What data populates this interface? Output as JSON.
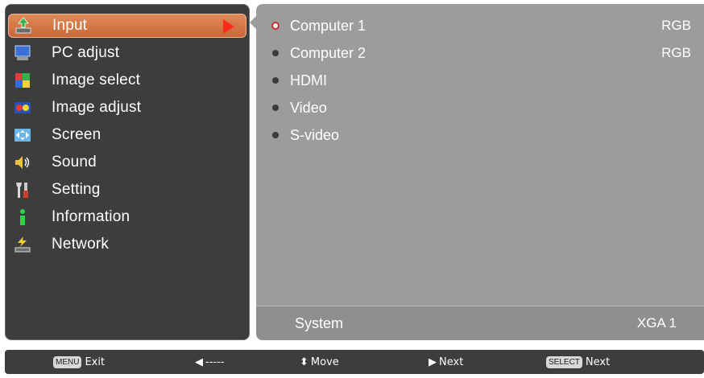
{
  "menu": {
    "items": [
      {
        "label": "Input",
        "icon": "input-icon",
        "selected": true
      },
      {
        "label": "PC adjust",
        "icon": "monitor-icon",
        "selected": false
      },
      {
        "label": "Image select",
        "icon": "image-select-icon",
        "selected": false
      },
      {
        "label": "Image adjust",
        "icon": "image-adjust-icon",
        "selected": false
      },
      {
        "label": "Screen",
        "icon": "screen-icon",
        "selected": false
      },
      {
        "label": "Sound",
        "icon": "speaker-icon",
        "selected": false
      },
      {
        "label": "Setting",
        "icon": "tools-icon",
        "selected": false
      },
      {
        "label": "Information",
        "icon": "info-icon",
        "selected": false
      },
      {
        "label": "Network",
        "icon": "network-icon",
        "selected": false
      }
    ]
  },
  "sources": {
    "items": [
      {
        "name": "Computer 1",
        "signal": "RGB",
        "active": true
      },
      {
        "name": "Computer 2",
        "signal": "RGB",
        "active": false
      },
      {
        "name": "HDMI",
        "signal": "",
        "active": false
      },
      {
        "name": "Video",
        "signal": "",
        "active": false
      },
      {
        "name": "S-video",
        "signal": "",
        "active": false
      }
    ]
  },
  "system": {
    "label": "System",
    "value": "XGA 1"
  },
  "guide": {
    "exit_key": "MENU",
    "exit_label": "Exit",
    "back_glyph": "◀",
    "back_label": "-----",
    "move_glyph": "⬍",
    "move_label": "Move",
    "next_glyph": "▶",
    "next_label": "Next",
    "select_key": "SELECT",
    "select_label": "Next"
  },
  "colors": {
    "selected_bg": "#d27546",
    "panel_dark": "#3d3d3d",
    "panel_grey": "#9c9c9c",
    "active_dot_ring": "#d22b2b",
    "arrow": "#ff2a1a"
  }
}
